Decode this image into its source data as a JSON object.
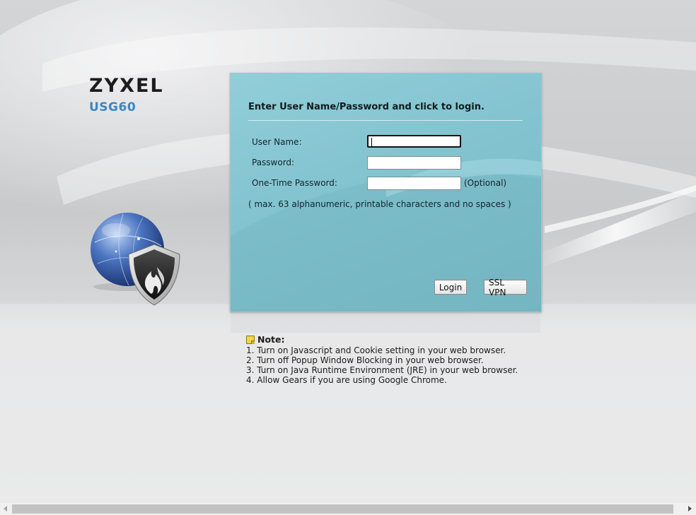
{
  "brand": {
    "logo": "ZYXEL",
    "model": "USG60"
  },
  "login": {
    "title": "Enter User Name/Password and click to login.",
    "username_label": "User Name:",
    "username_value": "",
    "password_label": "Password:",
    "password_value": "",
    "otp_label": "One-Time Password:",
    "otp_value": "",
    "otp_optional": "(Optional)",
    "hint": "( max. 63 alphanumeric, printable characters and no spaces )",
    "login_button": "Login",
    "sslvpn_button": "SSL VPN"
  },
  "note": {
    "heading": "Note:",
    "items": [
      "1. Turn on Javascript and Cookie setting in your web browser.",
      "2. Turn off Popup Window Blocking in your web browser.",
      "3. Turn on Java Runtime Environment (JRE) in your web browser.",
      "4. Allow Gears if you are using Google Chrome."
    ]
  },
  "colors": {
    "panel": "#86c6d2",
    "model_text": "#3a86c4",
    "note_icon": "#f3d64a"
  },
  "icons": {
    "globe": "globe-icon",
    "shield": "firewall-shield-icon",
    "note": "sticky-note-icon"
  }
}
